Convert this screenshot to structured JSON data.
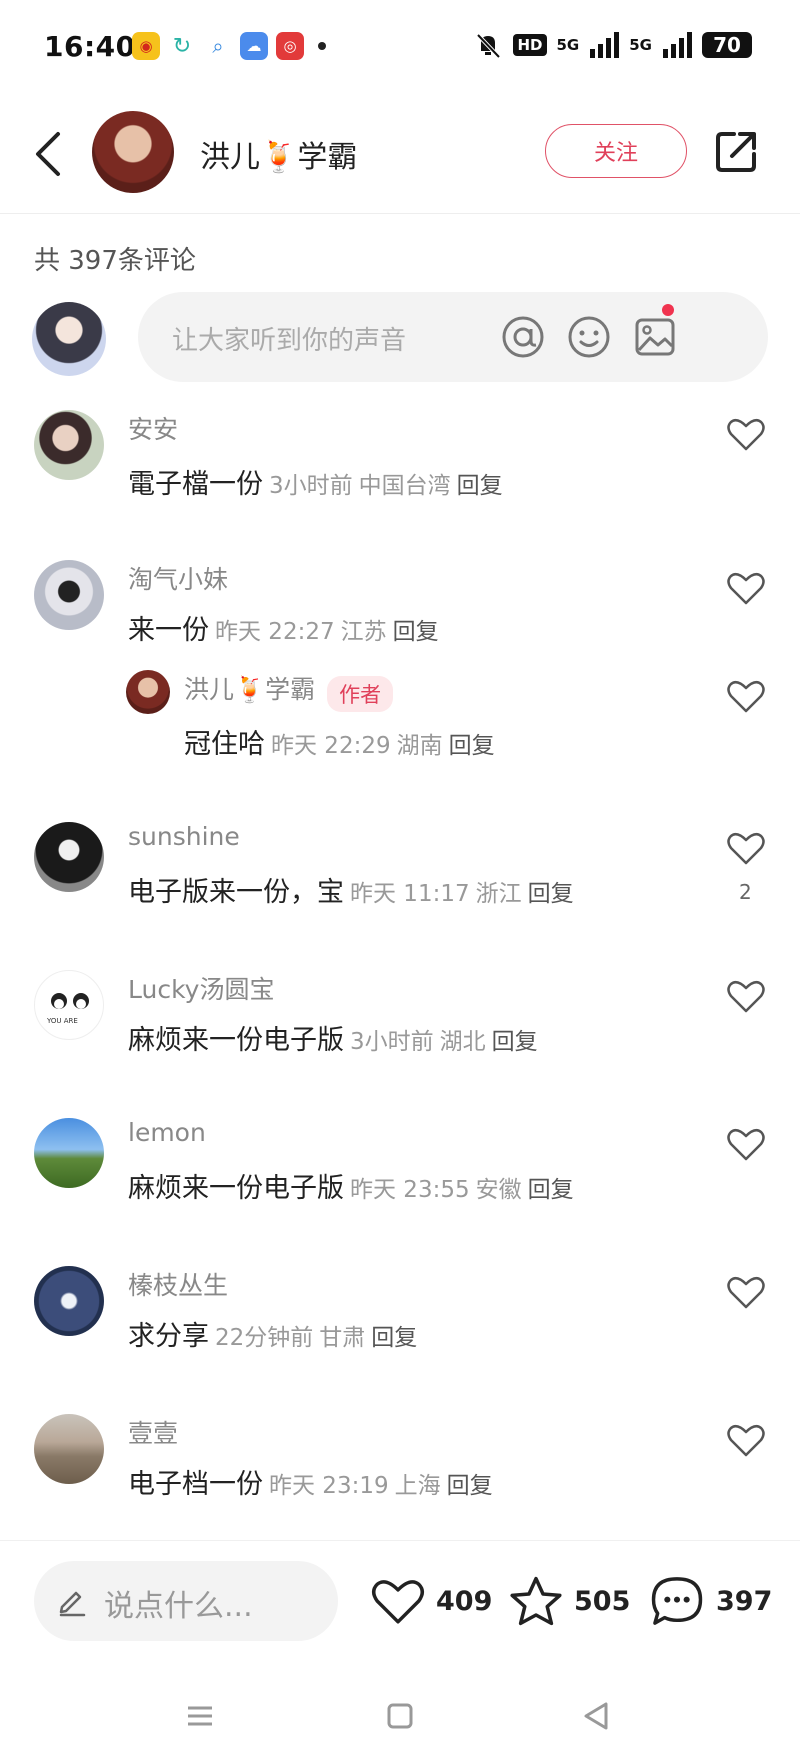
{
  "status_bar": {
    "time": "16:40",
    "network_1": "5G",
    "network_2": "5G",
    "hd": "HD",
    "battery": "70"
  },
  "header": {
    "author_name": "洪儿🍹学霸",
    "follow_label": "关注"
  },
  "comment_count_label": "共 397条评论",
  "input": {
    "placeholder": "让大家听到你的声音"
  },
  "comments": [
    {
      "name": "安安",
      "text": "電子檔一份",
      "time": "3小时前",
      "location": "中国台湾",
      "reply": "回复"
    },
    {
      "name": "淘气小妹",
      "text": "来一份",
      "time": "昨天 22:27",
      "location": "江苏",
      "reply": "回复",
      "sub_reply": {
        "name": "洪儿🍹学霸",
        "tag": "作者",
        "text": "冠住哈",
        "time": "昨天 22:29",
        "location": "湖南",
        "reply": "回复"
      }
    },
    {
      "name": "sunshine",
      "text": "电子版来一份，宝",
      "time": "昨天 11:17",
      "location": "浙江",
      "reply": "回复",
      "likes": "2"
    },
    {
      "name": "Lucky汤圆宝",
      "text": "麻烦来一份电子版",
      "time": "3小时前",
      "location": "湖北",
      "reply": "回复"
    },
    {
      "name": "lemon",
      "text": "麻烦来一份电子版",
      "time": "昨天 23:55",
      "location": "安徽",
      "reply": "回复"
    },
    {
      "name": "榛枝丛生",
      "text": "求分享",
      "time": "22分钟前",
      "location": "甘肃",
      "reply": "回复"
    },
    {
      "name": "壹壹",
      "text": "电子档一份",
      "time": "昨天 23:19",
      "location": "上海",
      "reply": "回复"
    }
  ],
  "bottom_bar": {
    "say_placeholder": "说点什么...",
    "likes": "409",
    "stars": "505",
    "comments": "397"
  },
  "colors": {
    "accent": "#e0405a",
    "text": "#222222",
    "meta": "#999999"
  }
}
